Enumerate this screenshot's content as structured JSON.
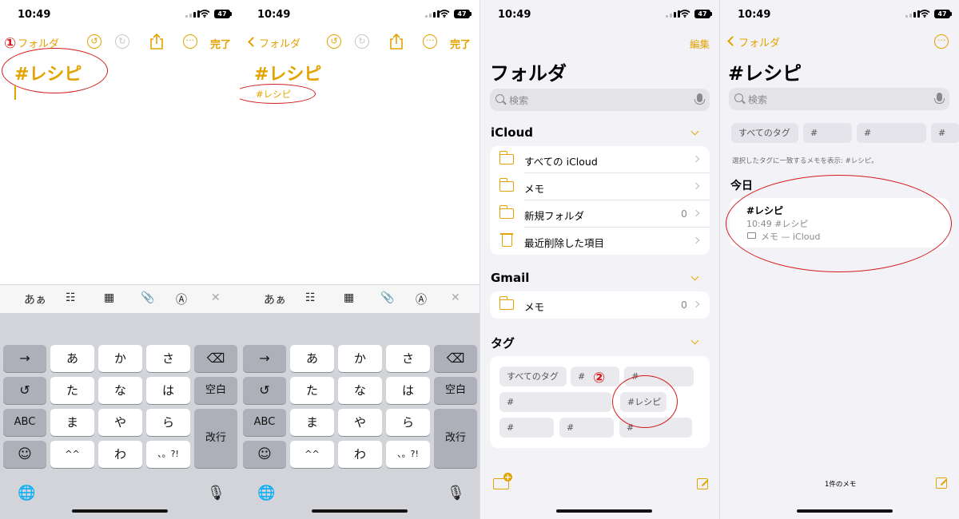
{
  "status": {
    "time": "10:49",
    "battery": "47"
  },
  "colors": {
    "accent": "#e3a300",
    "annotation": "#d31c1c",
    "keyboard_bg": "#d2d4da"
  },
  "annotations": {
    "step1": "①",
    "step2": "②"
  },
  "editor": {
    "back_label": "フォルダ",
    "done_label": "完了",
    "title": "#レシピ",
    "tag_line": "#レシピ",
    "icons": [
      "undo-icon",
      "redo-icon",
      "share-icon",
      "more-icon"
    ]
  },
  "keyboard": {
    "toolbar": {
      "format_label": "あぁ",
      "icons": [
        "checklist-icon",
        "table-icon",
        "attachment-icon",
        "markup-icon",
        "close-icon"
      ]
    },
    "row1": [
      "→",
      "あ",
      "か",
      "さ"
    ],
    "row2": [
      "た",
      "な",
      "は",
      "空白"
    ],
    "row3": [
      "ABC",
      "ま",
      "や",
      "ら",
      "改行"
    ],
    "row4": [
      "^^",
      "わ",
      "、。?!"
    ]
  },
  "folders": {
    "title": "フォルダ",
    "edit_label": "編集",
    "search_placeholder": "検索",
    "icloud": {
      "header": "iCloud",
      "rows": [
        {
          "label": "すべての iCloud",
          "count": ""
        },
        {
          "label": "メモ",
          "count": ""
        },
        {
          "label": "新規フォルダ",
          "count": "0"
        },
        {
          "label": "最近削除した項目",
          "count": ""
        }
      ]
    },
    "gmail": {
      "header": "Gmail",
      "rows": [
        {
          "label": "メモ",
          "count": "0"
        }
      ]
    },
    "tags": {
      "header": "タグ",
      "chips": [
        "すべてのタグ",
        "#",
        "#",
        "#",
        "#レシピ",
        "#",
        "#",
        "#"
      ]
    }
  },
  "tag_view": {
    "back_label": "フォルダ",
    "title": "#レシピ",
    "search_placeholder": "検索",
    "chips": [
      "すべてのタグ",
      "#",
      "#",
      "#"
    ],
    "filter_text": "選択したタグに一致するメモを表示: #レシピ。",
    "section": "今日",
    "note": {
      "title": "#レシピ",
      "meta": "10:49  #レシピ",
      "folder": "メモ — iCloud"
    },
    "count_label": "1件のメモ"
  }
}
